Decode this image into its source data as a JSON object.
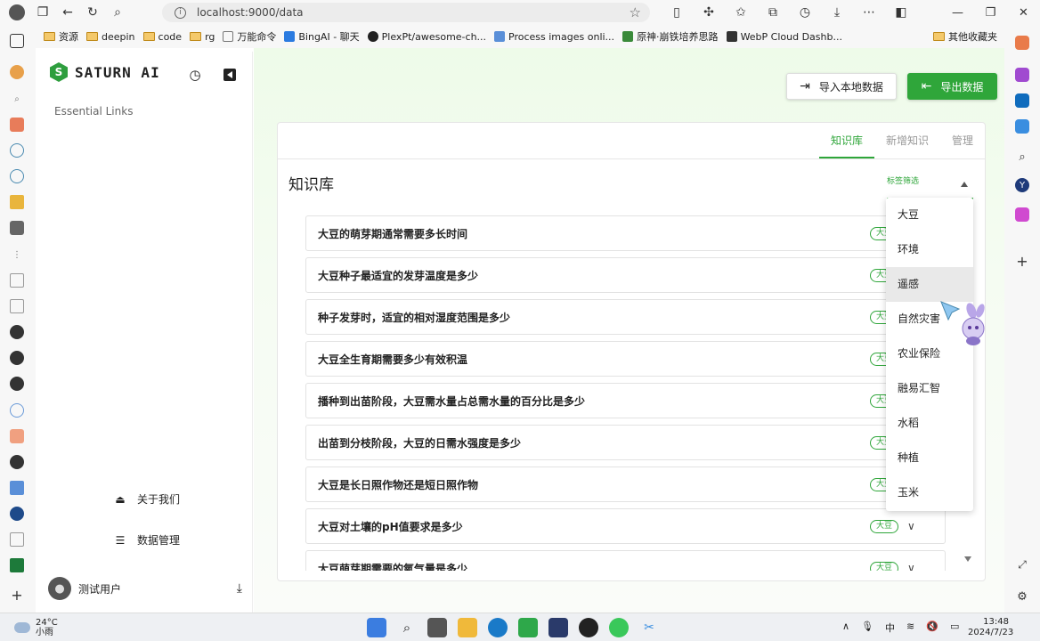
{
  "browser": {
    "address": "localhost:9000/data",
    "bookmarks": [
      {
        "label": "资源",
        "kind": "folder"
      },
      {
        "label": "deepin",
        "kind": "folder"
      },
      {
        "label": "code",
        "kind": "folder"
      },
      {
        "label": "rg",
        "kind": "folder"
      },
      {
        "label": "万能命令",
        "kind": "page"
      },
      {
        "label": "BingAI - 聊天",
        "kind": "bing"
      },
      {
        "label": "PlexPt/awesome-ch...",
        "kind": "github"
      },
      {
        "label": "Process images onli...",
        "kind": "web"
      },
      {
        "label": "原神·崩铁培养思路",
        "kind": "web"
      },
      {
        "label": "WebP Cloud Dashb...",
        "kind": "web"
      }
    ],
    "other_bookmarks": "其他收藏夹"
  },
  "app": {
    "logo_text": "SATURN AI",
    "essential_links": "Essential Links",
    "menu": {
      "about": "关于我们",
      "data_mgmt": "数据管理"
    },
    "user_name": "测试用户"
  },
  "toolbar": {
    "import_label": "导入本地数据",
    "export_label": "导出数据"
  },
  "card": {
    "tabs": [
      {
        "label": "知识库",
        "active": true
      },
      {
        "label": "新增知识",
        "active": false
      },
      {
        "label": "管理",
        "active": false
      }
    ],
    "title": "知识库",
    "filter_label": "标签筛选",
    "questions": [
      {
        "q": "大豆的萌芽期通常需要多长时间",
        "tag": "大豆"
      },
      {
        "q": "大豆种子最适宜的发芽温度是多少",
        "tag": "大豆"
      },
      {
        "q": "种子发芽时，适宜的相对湿度范围是多少",
        "tag": "大豆"
      },
      {
        "q": "大豆全生育期需要多少有效积温",
        "tag": "大豆"
      },
      {
        "q": "播种到出苗阶段，大豆需水量占总需水量的百分比是多少",
        "tag": "大豆"
      },
      {
        "q": "出苗到分枝阶段，大豆的日需水强度是多少",
        "tag": "大豆"
      },
      {
        "q": "大豆是长日照作物还是短日照作物",
        "tag": "大豆"
      },
      {
        "q": "大豆对土壤的pH值要求是多少",
        "tag": "大豆"
      },
      {
        "q": "大豆萌芽期需要的氧气量是多少",
        "tag": "大豆"
      }
    ],
    "dropdown_options": [
      "大豆",
      "环境",
      "遥感",
      "自然灾害",
      "农业保险",
      "融易汇智",
      "水稻",
      "种植",
      "玉米"
    ],
    "dropdown_hover": "遥感"
  },
  "taskbar": {
    "temp": "24°C",
    "weather": "小雨",
    "ime": "中",
    "time": "13:48",
    "date": "2024/7/23"
  },
  "colors": {
    "accent": "#2fa63a",
    "background_tint": "#eefbe9"
  }
}
